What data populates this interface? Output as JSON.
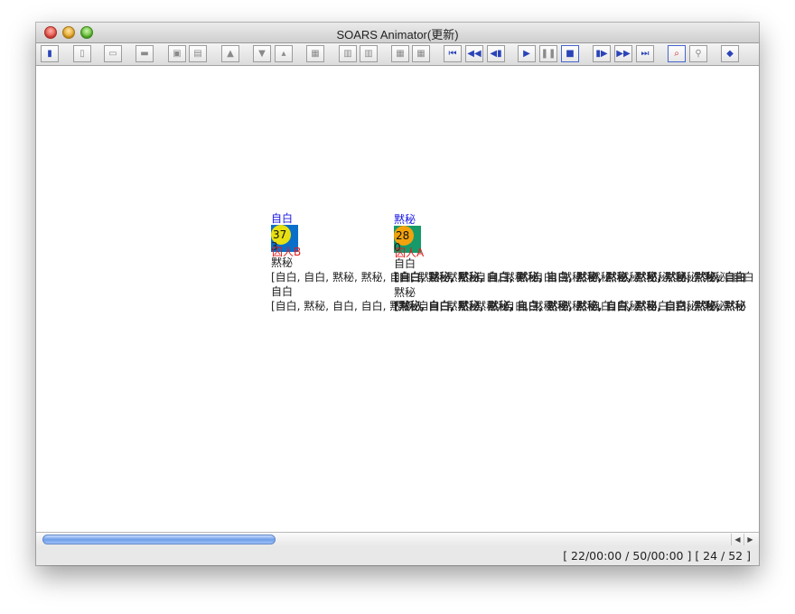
{
  "window": {
    "title": "SOARS Animator(更新)"
  },
  "toolbar": {
    "buttons": [
      {
        "icon": "book-icon",
        "glyph": "▮"
      },
      {
        "icon": "page-icon",
        "glyph": "▯"
      },
      {
        "icon": "tag-icon",
        "glyph": "▭"
      },
      {
        "icon": "folder-icon",
        "glyph": "▬"
      },
      {
        "icon": "disk-icon",
        "glyph": "▣"
      },
      {
        "icon": "save-as-icon",
        "glyph": "▤"
      },
      {
        "icon": "export-icon",
        "glyph": "▲"
      },
      {
        "icon": "import-icon",
        "glyph": "▼"
      },
      {
        "icon": "upload-icon",
        "glyph": "▴"
      },
      {
        "icon": "calendar-icon",
        "glyph": "▦"
      },
      {
        "icon": "table-icon",
        "glyph": "▥"
      },
      {
        "icon": "table-alt-icon",
        "glyph": "▥"
      },
      {
        "icon": "grid-icon",
        "glyph": "▦"
      },
      {
        "icon": "grid-alt-icon",
        "glyph": "▦"
      },
      {
        "icon": "first-frame-icon",
        "glyph": "⏮"
      },
      {
        "icon": "rewind-icon",
        "glyph": "◀◀"
      },
      {
        "icon": "step-back-icon",
        "glyph": "◀▮"
      },
      {
        "icon": "play-icon",
        "glyph": "▶"
      },
      {
        "icon": "pause-icon",
        "glyph": "❚❚"
      },
      {
        "icon": "stop-icon",
        "glyph": "■"
      },
      {
        "icon": "step-forward-icon",
        "glyph": "▮▶"
      },
      {
        "icon": "fast-forward-icon",
        "glyph": "▶▶"
      },
      {
        "icon": "last-frame-icon",
        "glyph": "⏭"
      },
      {
        "icon": "zoom-in-icon",
        "glyph": "⌕"
      },
      {
        "icon": "zoom-out-icon",
        "glyph": "⚲"
      },
      {
        "icon": "resize-icon",
        "glyph": "◆"
      }
    ]
  },
  "agents": [
    {
      "header": "自白",
      "value": "37",
      "count": "3",
      "name": "囚人B",
      "line1_label": "黙秘",
      "line1_history": "[自白, 自白, 黙秘, 黙秘, 自白, 黙秘, 黙秘, 自白, 黙秘, 自白, 黙秘, 黙秘, 黙秘, 黙秘, 黙秘, 黙秘, 自白",
      "line2_label": "自白",
      "line2_history": "[自白, 黙秘, 自白, 自白, 黙秘, 自白, 黙秘, 黙秘, 自白, 黙秘, 黙秘, 自白, 黙秘, 自白, 黙秘, 黙秘",
      "square_color": "#0a6fc9",
      "circle_color": "#e8e011"
    },
    {
      "header": "黙秘",
      "value": "28",
      "count": "0",
      "name": "囚人A",
      "line1_label": "自白",
      "line1_history": "[自白, 黙秘, 黙秘, 自白, 黙秘, 自白, 黙秘, 黙秘, 黙秘, 黙秘, 黙秘, 自白",
      "line2_label": "黙秘",
      "line2_history": "[黙秘, 自白, 黙秘, 黙秘, 自白, 黙秘, 黙秘, 自白, 黙秘, 自白, 黙秘, 黙秘",
      "square_color": "#169a6a",
      "circle_color": "#f2a20c"
    }
  ],
  "status": {
    "text": "[ 22/00:00 / 50/00:00 ] [ 24 / 52 ]"
  },
  "colors": {
    "header_text": "#1a1ae6",
    "name_text": "#e61a1a"
  }
}
